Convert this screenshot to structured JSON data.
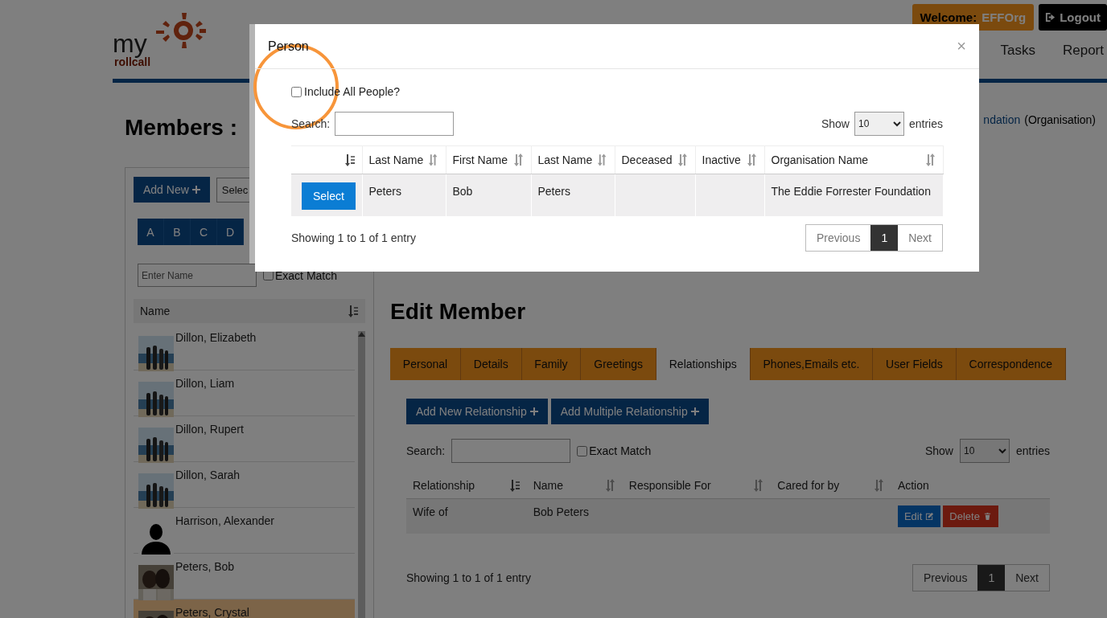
{
  "header": {
    "logo": {
      "word": "my",
      "subword": "rollcall"
    },
    "welcome": {
      "label": "Welcome:",
      "user": "EFFOrg"
    },
    "logout": "Logout",
    "nav": [
      "Tasks",
      "Report"
    ],
    "breadcrumb": {
      "name": "ndation",
      "type": "(Organisation)"
    }
  },
  "members": {
    "title": "Members :",
    "add_button": "Add New",
    "select_text": "Selec",
    "letters": [
      "A",
      "B",
      "C",
      "D"
    ],
    "name_placeholder": "Enter Name",
    "exact_match": {
      "label": "Exact Match",
      "checked": false
    },
    "column": "Name",
    "rows": [
      {
        "name": "Dillon, Elizabeth",
        "kind": "group_photo",
        "selected": false
      },
      {
        "name": "Dillon, Liam",
        "kind": "group_photo",
        "selected": false
      },
      {
        "name": "Dillon, Rupert",
        "kind": "group_photo",
        "selected": false
      },
      {
        "name": "Dillon, Sarah",
        "kind": "group_photo",
        "selected": false
      },
      {
        "name": "Harrison, Alexander",
        "kind": "silhouette",
        "selected": false
      },
      {
        "name": "Peters, Bob",
        "kind": "couple_photo",
        "selected": false
      },
      {
        "name": "Peters, Crystal",
        "kind": "couple_photo",
        "selected": true
      }
    ]
  },
  "edit_member": {
    "title": "Edit Member",
    "tabs": [
      {
        "label": "Personal",
        "selected": false
      },
      {
        "label": "Details",
        "selected": false
      },
      {
        "label": "Family",
        "selected": false
      },
      {
        "label": "Greetings",
        "selected": false
      },
      {
        "label": "Relationships",
        "selected": true
      },
      {
        "label": "Phones,Emails etc.",
        "selected": false
      },
      {
        "label": "User Fields",
        "selected": false
      },
      {
        "label": "Correspondence",
        "selected": false
      }
    ],
    "buttons": [
      "Add New Relationship",
      "Add Multiple Relationship"
    ],
    "search_label": "Search:",
    "exact_match": {
      "label": "Exact Match",
      "checked": false
    },
    "show": "Show",
    "page_size": "10",
    "entries": "entries",
    "columns": [
      {
        "label": "Relationship",
        "sorted": true
      },
      {
        "label": "Name",
        "sorted": false
      },
      {
        "label": "Responsible For",
        "sorted": false
      },
      {
        "label": "Cared for by",
        "sorted": false
      },
      {
        "label": "Action"
      }
    ],
    "rows": [
      {
        "relationship": "Wife of",
        "name": "Bob Peters",
        "edit": "Edit",
        "delete": "Delete"
      }
    ],
    "info": "Showing 1 to 1 of 1 entry",
    "pagination": {
      "previous": "Previous",
      "pages": [
        {
          "label": "1",
          "selected": true
        }
      ],
      "next": "Next"
    }
  },
  "modal": {
    "title": "Person",
    "close": "×",
    "include_all": {
      "label": "Include All People?",
      "checked": false
    },
    "search_label": "Search:",
    "show": "Show",
    "page_size": "10",
    "entries": "entries",
    "columns": [
      {
        "sorted": true
      },
      {
        "label": "Last Name",
        "sorted": false
      },
      {
        "label": "First Name",
        "sorted": false
      },
      {
        "label": "Last Name",
        "sorted": false
      },
      {
        "label": "Deceased",
        "sorted": false
      },
      {
        "label": "Inactive",
        "sorted": false
      },
      {
        "label": "Organisation Name",
        "sorted": false
      }
    ],
    "rows": [
      {
        "action": "Select",
        "last_name": "Peters",
        "first_name": "Bob",
        "last_name_2": "Peters",
        "organisation": "The Eddie Forrester Foundation"
      }
    ],
    "info": "Showing 1 to 1 of 1 entry",
    "pagination": {
      "previous": "Previous",
      "pages": [
        {
          "label": "1",
          "selected": true
        }
      ],
      "next": "Next"
    }
  }
}
